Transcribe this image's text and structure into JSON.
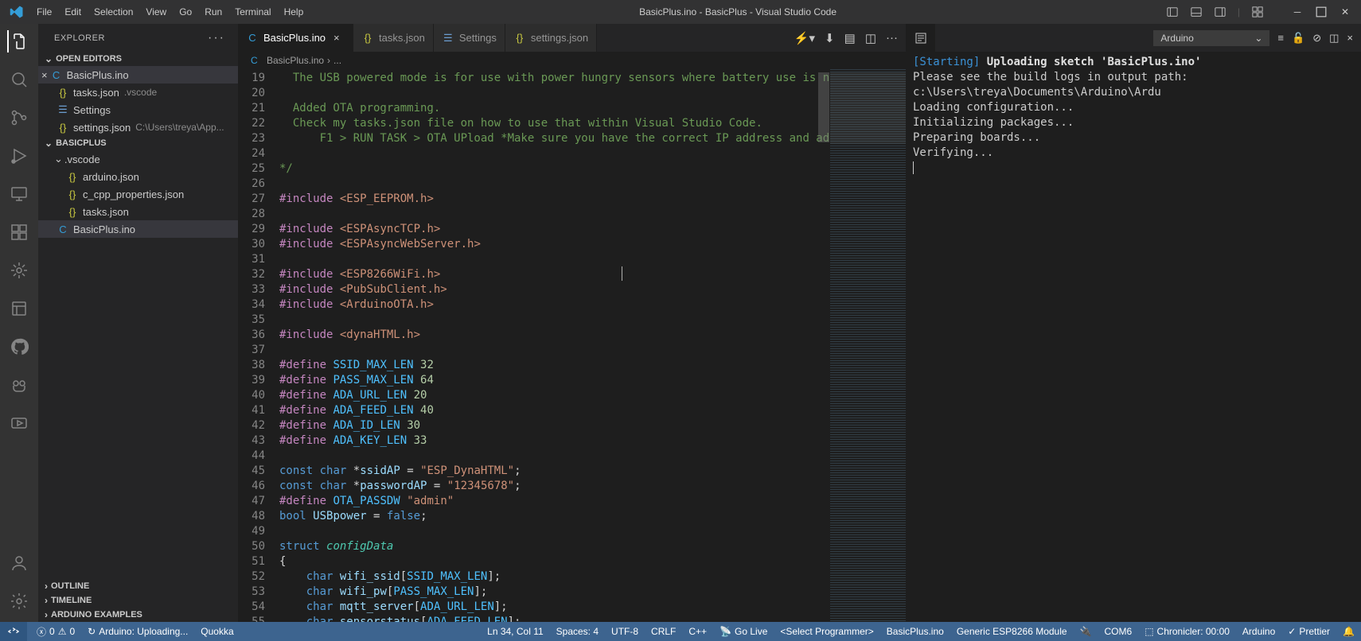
{
  "title": "BasicPlus.ino - BasicPlus - Visual Studio Code",
  "menu": [
    "File",
    "Edit",
    "Selection",
    "View",
    "Go",
    "Run",
    "Terminal",
    "Help"
  ],
  "explorer": {
    "title": "EXPLORER",
    "open_editors": "OPEN EDITORS",
    "workspace": "BASICPLUS",
    "outline": "OUTLINE",
    "timeline": "TIMELINE",
    "arduino_examples": "ARDUINO EXAMPLES",
    "vscode_folder": ".vscode",
    "open_files": [
      {
        "name": "BasicPlus.ino",
        "desc": ""
      },
      {
        "name": "tasks.json",
        "desc": ".vscode"
      },
      {
        "name": "Settings",
        "desc": ""
      },
      {
        "name": "settings.json",
        "desc": "C:\\Users\\treya\\App..."
      }
    ],
    "files": [
      {
        "name": "arduino.json"
      },
      {
        "name": "c_cpp_properties.json"
      },
      {
        "name": "tasks.json"
      },
      {
        "name": "BasicPlus.ino"
      }
    ]
  },
  "tabs": [
    {
      "label": "BasicPlus.ino",
      "active": true,
      "icon": "ino"
    },
    {
      "label": "tasks.json",
      "active": false,
      "icon": "json"
    },
    {
      "label": "Settings",
      "active": false,
      "icon": "gear"
    },
    {
      "label": "settings.json",
      "active": false,
      "icon": "json"
    }
  ],
  "breadcrumb": {
    "file": "BasicPlus.ino",
    "more": "..."
  },
  "code_start_line": 19,
  "code_lines": [
    {
      "t": "  The USB powered mode is for use with power hungry sensors where battery use is n",
      "cls": "c-comment"
    },
    {
      "t": "",
      "cls": ""
    },
    {
      "t": "  Added OTA programming.",
      "cls": "c-comment"
    },
    {
      "t": "  Check my tasks.json file on how to use that within Visual Studio Code.",
      "cls": "c-comment"
    },
    {
      "t": "      F1 > RUN TASK > OTA UPload *Make sure you have the correct IP address and ad",
      "cls": "c-comment"
    },
    {
      "t": "",
      "cls": ""
    },
    {
      "t": "*/",
      "cls": "c-comment"
    },
    {
      "t": "",
      "cls": ""
    }
  ],
  "includes": [
    "<ESP_EEPROM.h>",
    "",
    "<ESPAsyncTCP.h>",
    "<ESPAsyncWebServer.h>",
    "",
    "<ESP8266WiFi.h>",
    "<PubSubClient.h>",
    "<ArduinoOTA.h>",
    "",
    "<dynaHTML.h>",
    ""
  ],
  "defines": [
    {
      "name": "SSID_MAX_LEN",
      "val": "32"
    },
    {
      "name": "PASS_MAX_LEN",
      "val": "64"
    },
    {
      "name": "ADA_URL_LEN",
      "val": "20"
    },
    {
      "name": "ADA_FEED_LEN",
      "val": "40"
    },
    {
      "name": "ADA_ID_LEN",
      "val": "30"
    },
    {
      "name": "ADA_KEY_LEN",
      "val": "33"
    }
  ],
  "consts": {
    "ssidAP": "\"ESP_DynaHTML\"",
    "passwordAP": "\"12345678\"",
    "ota_passdw": "\"admin\"",
    "usbpower": "false"
  },
  "struct": {
    "name": "configData",
    "fields": [
      {
        "n": "wifi_ssid",
        "len": "SSID_MAX_LEN"
      },
      {
        "n": "wifi_pw",
        "len": "PASS_MAX_LEN"
      },
      {
        "n": "mqtt_server",
        "len": "ADA_URL_LEN"
      },
      {
        "n": "sensorstatus",
        "len": "ADA_FEED_LEN"
      }
    ]
  },
  "output": {
    "channel": "Arduino",
    "lines": [
      {
        "prefix": "[Starting]",
        "text": "Uploading sketch 'BasicPlus.ino'",
        "bold": true
      },
      {
        "text": "Please see the build logs in output path: c:\\Users\\treya\\Documents\\Arduino\\Ardu"
      },
      {
        "text": "Loading configuration..."
      },
      {
        "text": "Initializing packages..."
      },
      {
        "text": "Preparing boards..."
      },
      {
        "text": "Verifying..."
      }
    ]
  },
  "status": {
    "errors": "0",
    "warnings": "0",
    "arduino": "Arduino: Uploading...",
    "quokka": "Quokka",
    "ln": "Ln 34, Col 11",
    "spaces": "Spaces: 4",
    "encoding": "UTF-8",
    "eol": "CRLF",
    "lang": "C++",
    "golive": "Go Live",
    "programmer": "<Select Programmer>",
    "sketch": "BasicPlus.ino",
    "board": "Generic ESP8266 Module",
    "port": "COM6",
    "chronicler": "Chronicler: 00:00",
    "arduino2": "Arduino",
    "prettier": "Prettier"
  }
}
